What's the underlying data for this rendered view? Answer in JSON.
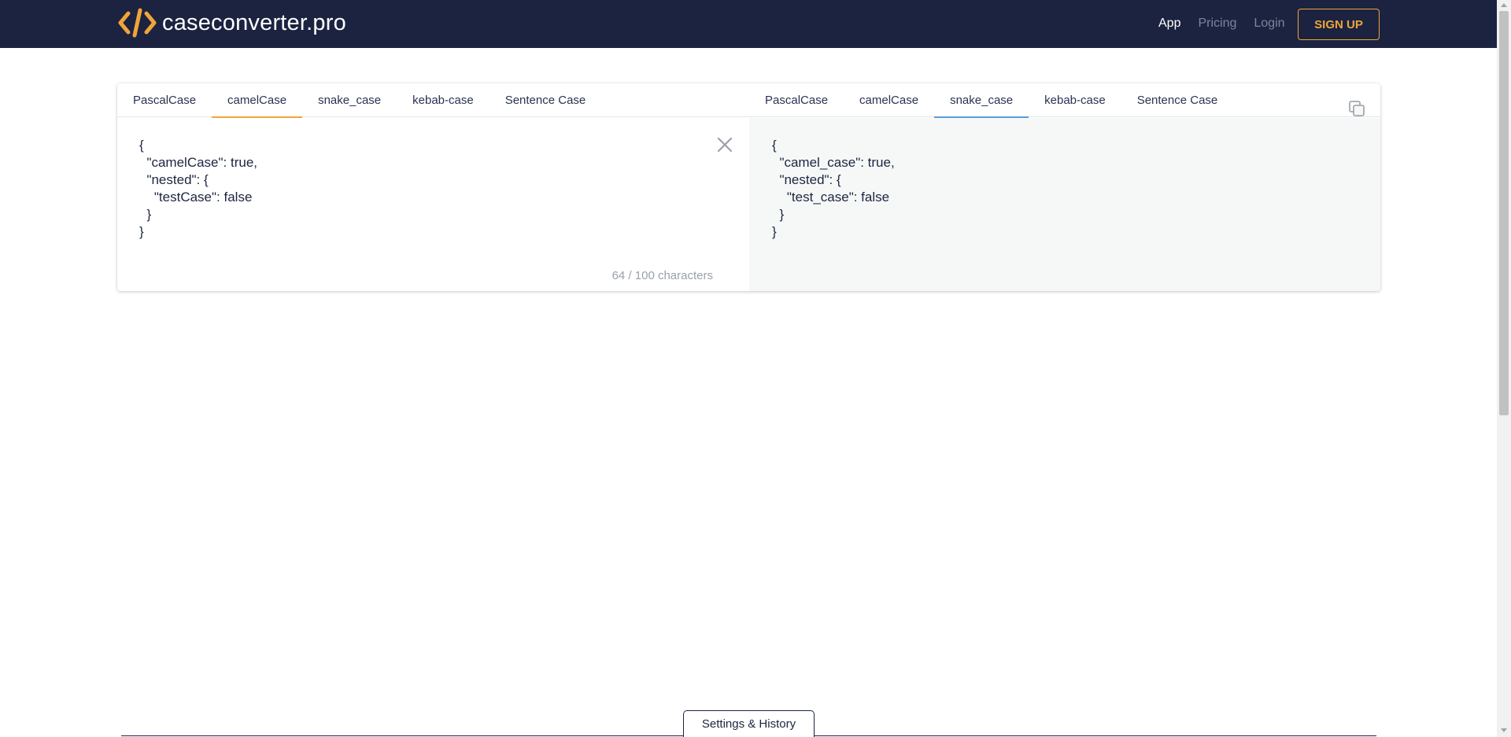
{
  "header": {
    "brand": "caseconverter.pro",
    "nav": [
      {
        "label": "App"
      },
      {
        "label": "Pricing"
      },
      {
        "label": "Login"
      }
    ],
    "signup_label": "SIGN UP"
  },
  "colors": {
    "header_bg": "#1b2340",
    "accent_orange": "#f0a43a",
    "accent_blue": "#5b9bd5",
    "output_bg": "#f6f8f8"
  },
  "converter": {
    "input_tabs": [
      "PascalCase",
      "camelCase",
      "snake_case",
      "kebab-case",
      "Sentence Case"
    ],
    "input_active": "camelCase",
    "output_tabs": [
      "PascalCase",
      "camelCase",
      "snake_case",
      "kebab-case",
      "Sentence Case"
    ],
    "output_active": "snake_case",
    "input_text": "{\n  \"camelCase\": true,\n  \"nested\": {\n    \"testCase\": false\n  }\n}",
    "output_text": "{\n  \"camel_case\": true,\n  \"nested\": {\n    \"test_case\": false\n  }\n}",
    "char_count": "64 / 100 characters",
    "clear_icon": "close-icon",
    "copy_icon": "copy-icon"
  },
  "footer": {
    "settings_label": "Settings & History"
  }
}
